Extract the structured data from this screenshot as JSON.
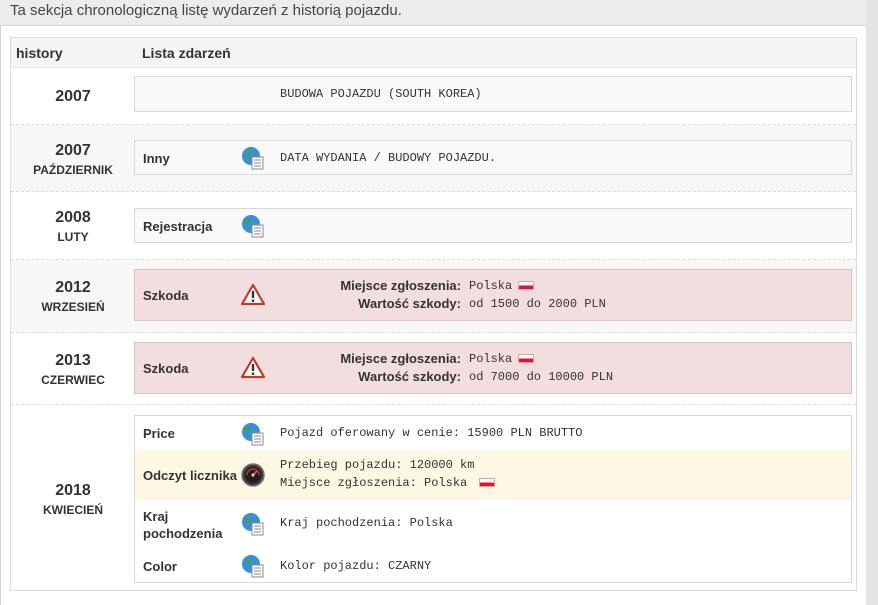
{
  "intro_text": "Ta sekcja chronologiczną listę wydarzeń z historią pojazdu.",
  "table": {
    "col_history": "history",
    "col_events": "Lista zdarzeń"
  },
  "rows": [
    {
      "year": "2007",
      "month": "",
      "events": [
        {
          "label": "",
          "icon": "none",
          "text": "BUDOWA POJAZDU (SOUTH KOREA)"
        }
      ]
    },
    {
      "year": "2007",
      "month": "PAŹDZIERNIK",
      "events": [
        {
          "label": "Inny",
          "icon": "globe-document-icon",
          "text": "DATA WYDANIA / BUDOWY POJAZDU."
        }
      ]
    },
    {
      "year": "2008",
      "month": "LUTY",
      "events": [
        {
          "label": "Rejestracja",
          "icon": "globe-document-icon",
          "text": ""
        }
      ]
    },
    {
      "year": "2012",
      "month": "WRZESIEŃ",
      "events": [
        {
          "label": "Szkoda",
          "icon": "warning-icon",
          "place_key": "Miejsce zgłoszenia:",
          "place_value": "Polska",
          "value_key": "Wartość szkody:",
          "value_value": "od 1500 do 2000 PLN"
        }
      ]
    },
    {
      "year": "2013",
      "month": "CZERWIEC",
      "events": [
        {
          "label": "Szkoda",
          "icon": "warning-icon",
          "place_key": "Miejsce zgłoszenia:",
          "place_value": "Polska",
          "value_key": "Wartość szkody:",
          "value_value": "od 7000 do 10000 PLN"
        }
      ]
    },
    {
      "year": "2018",
      "month": "KWIECIEŃ",
      "events": [
        {
          "label": "Price",
          "icon": "globe-document-icon",
          "text": "Pojazd oferowany w cenie: 15900 PLN BRUTTO"
        },
        {
          "label": "Odczyt licznika",
          "icon": "speedometer-icon",
          "line1": "Przebieg pojazdu: 120000 km",
          "line2": "Miejsce zgłoszenia: Polska"
        },
        {
          "label_line1": "Kraj",
          "label_line2": "pochodzenia",
          "icon": "globe-document-icon",
          "text": "Kraj pochodzenia: Polska"
        },
        {
          "label": "Color",
          "icon": "globe-document-icon",
          "text": "Kolor pojazdu: CZARNY"
        }
      ]
    }
  ],
  "colors": {
    "danger_bg": "#f2dede",
    "meter_bg": "#fcf8e3",
    "flag_red": "#dc143c"
  }
}
